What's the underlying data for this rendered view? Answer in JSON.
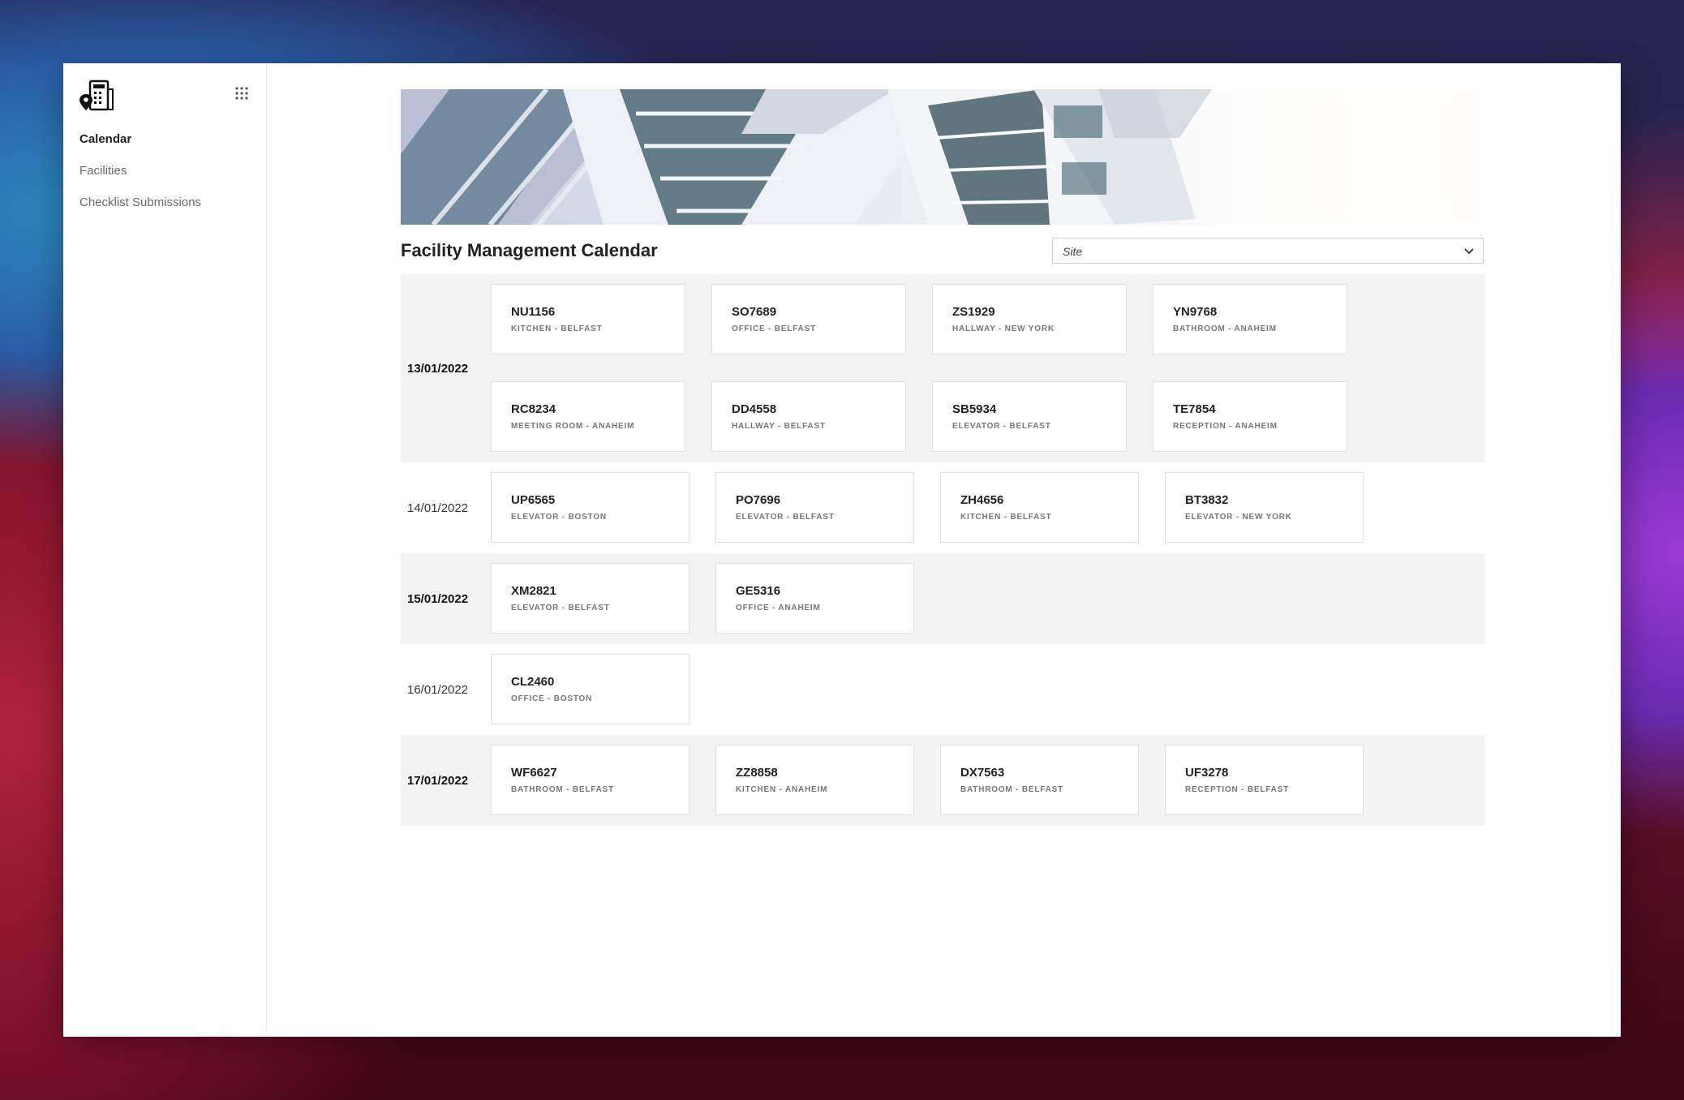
{
  "sidebar": {
    "logo_icon": "facility-building-icon",
    "apps_icon": "apps-grid-icon",
    "items": [
      {
        "label": "Calendar",
        "active": true
      },
      {
        "label": "Facilities",
        "active": false
      },
      {
        "label": "Checklist Submissions",
        "active": false
      }
    ]
  },
  "main": {
    "title": "Facility Management Calendar",
    "site_select": {
      "placeholder": "Site",
      "icon": "chevron-down-icon"
    }
  },
  "calendar": {
    "days": [
      {
        "date": "13/01/2022",
        "tasks": [
          {
            "code": "NU1156",
            "location": "KITCHEN - BELFAST"
          },
          {
            "code": "SO7689",
            "location": "OFFICE - BELFAST"
          },
          {
            "code": "ZS1929",
            "location": "HALLWAY - NEW YORK"
          },
          {
            "code": "YN9768",
            "location": "BATHROOM - ANAHEIM"
          },
          {
            "code": "RC8234",
            "location": "MEETING ROOM - ANAHEIM"
          },
          {
            "code": "DD4558",
            "location": "HALLWAY - BELFAST"
          },
          {
            "code": "SB5934",
            "location": "ELEVATOR - BELFAST"
          },
          {
            "code": "TE7854",
            "location": "RECEPTION - ANAHEIM"
          }
        ]
      },
      {
        "date": "14/01/2022",
        "tasks": [
          {
            "code": "UP6565",
            "location": "ELEVATOR - BOSTON"
          },
          {
            "code": "PO7696",
            "location": "ELEVATOR - BELFAST"
          },
          {
            "code": "ZH4656",
            "location": "KITCHEN - BELFAST"
          },
          {
            "code": "BT3832",
            "location": "ELEVATOR - NEW YORK"
          }
        ]
      },
      {
        "date": "15/01/2022",
        "tasks": [
          {
            "code": "XM2821",
            "location": "ELEVATOR - BELFAST"
          },
          {
            "code": "GE5316",
            "location": "OFFICE - ANAHEIM"
          }
        ]
      },
      {
        "date": "16/01/2022",
        "tasks": [
          {
            "code": "CL2460",
            "location": "OFFICE - BOSTON"
          }
        ]
      },
      {
        "date": "17/01/2022",
        "tasks": [
          {
            "code": "WF6627",
            "location": "BATHROOM - BELFAST"
          },
          {
            "code": "ZZ8858",
            "location": "KITCHEN - ANAHEIM"
          },
          {
            "code": "DX7563",
            "location": "BATHROOM - BELFAST"
          },
          {
            "code": "UF3278",
            "location": "RECEPTION - BELFAST"
          }
        ]
      }
    ]
  }
}
